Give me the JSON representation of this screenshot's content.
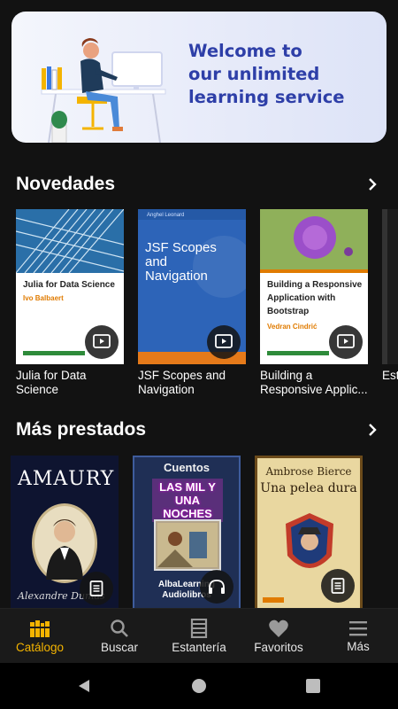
{
  "banner": {
    "line1": "Welcome to",
    "line2": "our unlimited",
    "line3": "learning service"
  },
  "sections": {
    "novedades": {
      "title": "Novedades",
      "items": [
        {
          "title": "Julia for Data Science",
          "cover_title": "Julia for Data Science",
          "cover_author": "Ivo Balbaert",
          "media": "video-icon"
        },
        {
          "title": "JSF Scopes and Navigation",
          "cover_top": "Anghel Leonard",
          "cover_title": "JSF Scopes and Navigation",
          "media": "video-icon"
        },
        {
          "title": "Building a Responsive Applic...",
          "cover_title": "Building a Responsive Application with Bootstrap",
          "cover_author": "Vedran Cindrić",
          "media": "video-icon"
        },
        {
          "title": "Est"
        }
      ]
    },
    "mas_prestados": {
      "title": "Más prestados",
      "items": [
        {
          "cover_title": "Amaury",
          "cover_author": "Alexandre Dumas",
          "media": "document-icon"
        },
        {
          "cover_top": "Cuentos",
          "cover_title": "LAS MIL Y UNA NOCHES",
          "cover_footer": "AlbaLearning Audiolibros",
          "media": "headphones-icon"
        },
        {
          "cover_top": "Ambrose Bierce",
          "cover_title": "Una pelea dura",
          "media": "document-icon"
        }
      ]
    }
  },
  "nav": {
    "items": [
      {
        "label": "Catálogo",
        "icon": "books-icon",
        "active": true
      },
      {
        "label": "Buscar",
        "icon": "search-icon"
      },
      {
        "label": "Estantería",
        "icon": "shelf-icon"
      },
      {
        "label": "Favoritos",
        "icon": "heart-icon"
      },
      {
        "label": "Más",
        "icon": "menu-icon"
      }
    ]
  },
  "colors": {
    "accent": "#f4b400",
    "background": "#121212",
    "banner_text": "#2e3fa8"
  }
}
